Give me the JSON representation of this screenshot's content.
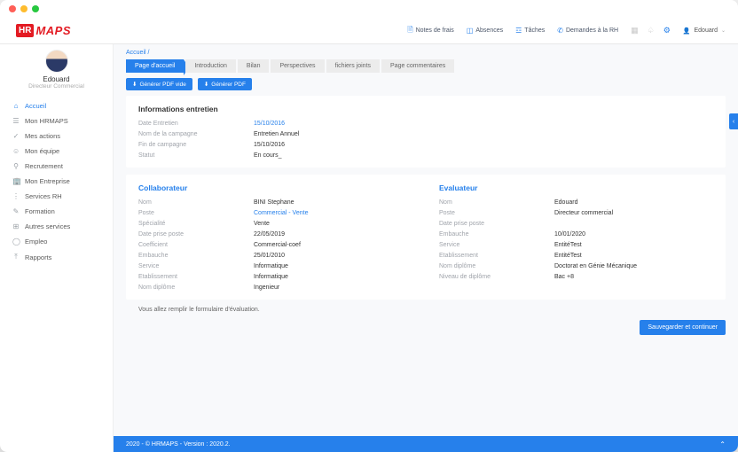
{
  "brand": {
    "badge": "HR",
    "name": "MAPS"
  },
  "topnav": {
    "items": [
      {
        "label": "Notes de frais"
      },
      {
        "label": "Absences"
      },
      {
        "label": "Tâches"
      },
      {
        "label": "Demandes à la RH"
      }
    ],
    "user": "Edouard"
  },
  "profile": {
    "name": "Edouard",
    "role": "Directeur Commercial"
  },
  "sidebar": {
    "items": [
      {
        "label": "Accueil",
        "icon": "⌂",
        "active": true
      },
      {
        "label": "Mon HRMAPS",
        "icon": "☰"
      },
      {
        "label": "Mes actions",
        "icon": "✓"
      },
      {
        "label": "Mon équipe",
        "icon": "☺"
      },
      {
        "label": "Recrutement",
        "icon": "⚲"
      },
      {
        "label": "Mon Entreprise",
        "icon": "🏢"
      },
      {
        "label": "Services RH",
        "icon": "⋮"
      },
      {
        "label": "Formation",
        "icon": "✎"
      },
      {
        "label": "Autres services",
        "icon": "⊞"
      },
      {
        "label": "Empleo",
        "icon": "◯"
      },
      {
        "label": "Rapports",
        "icon": "⤒"
      }
    ]
  },
  "breadcrumb": "Accueil /",
  "tabs": [
    {
      "label": "Page d'accueil",
      "active": true
    },
    {
      "label": "Introduction"
    },
    {
      "label": "Bilan"
    },
    {
      "label": "Perspectives"
    },
    {
      "label": "fichiers joints"
    },
    {
      "label": "Page commentaires"
    }
  ],
  "buttons": {
    "pdf_blank": "Générer PDF vide",
    "pdf": "Générer PDF",
    "save": "Sauvegarder et continuer"
  },
  "sections": {
    "interview": {
      "title": "Informations entretien",
      "rows": [
        {
          "k": "Date Entretien",
          "v": "15/10/2016",
          "link": true
        },
        {
          "k": "Nom de la campagne",
          "v": "Entretien Annuel"
        },
        {
          "k": "Fin de campagne",
          "v": "15/10/2016"
        },
        {
          "k": "Statut",
          "v": "En cours_"
        }
      ]
    },
    "collaborator": {
      "title": "Collaborateur",
      "rows": [
        {
          "k": "Nom",
          "v": "BINI Stephane"
        },
        {
          "k": "Poste",
          "v": "Commercial - Vente",
          "link": true
        },
        {
          "k": "Spécialité",
          "v": "Vente"
        },
        {
          "k": "Date prise poste",
          "v": "22/05/2019"
        },
        {
          "k": "Coefficient",
          "v": "Commercial-coef"
        },
        {
          "k": "Embauche",
          "v": "25/01/2010"
        },
        {
          "k": "Service",
          "v": "Informatique"
        },
        {
          "k": "Etablissement",
          "v": "Informatique"
        },
        {
          "k": "Nom diplôme",
          "v": "Ingenieur"
        }
      ]
    },
    "evaluator": {
      "title": "Evaluateur",
      "rows": [
        {
          "k": "Nom",
          "v": "Edouard"
        },
        {
          "k": "Poste",
          "v": "Directeur commercial"
        },
        {
          "k": "Date prise poste",
          "v": ""
        },
        {
          "k": "Embauche",
          "v": "10/01/2020"
        },
        {
          "k": "Service",
          "v": "EntitéTest"
        },
        {
          "k": "Etablissement",
          "v": "EntitéTest"
        },
        {
          "k": "Nom diplôme",
          "v": "Doctorat en Génie Mécanique"
        },
        {
          "k": "Niveau de diplôme",
          "v": "Bac +8"
        }
      ]
    }
  },
  "note": "Vous allez remplir le formulaire d'évaluation.",
  "footer": "2020 - © HRMAPS - Version : 2020.2."
}
